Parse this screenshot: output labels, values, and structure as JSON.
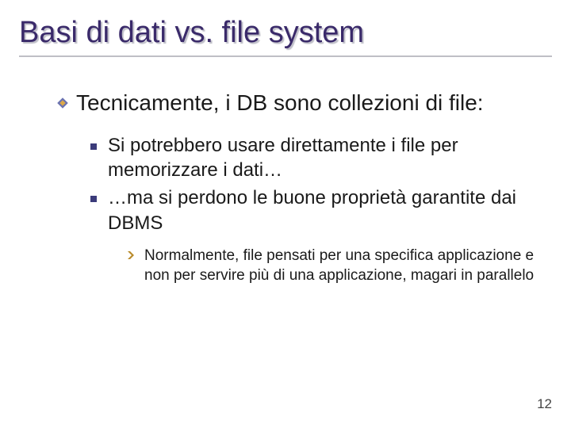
{
  "title": "Basi di dati vs. file system",
  "bullets": {
    "lvl1": "Tecnicamente, i DB sono collezioni di file:",
    "lvl2": [
      "Si potrebbero usare direttamente i file per memorizzare i dati…",
      "…ma si perdono le buone proprietà garantite dai DBMS"
    ],
    "lvl3": [
      "Normalmente, file pensati per una specifica applicazione e non per servire più di una applicazione, magari in parallelo"
    ]
  },
  "page_number": "12",
  "colors": {
    "title": "#3a2a6a",
    "bullet_diamond_outer": "#6a72b0",
    "bullet_diamond_inner": "#dca848",
    "bullet_square": "#3b3b7a",
    "bullet_chevron": "#b88a2a"
  }
}
